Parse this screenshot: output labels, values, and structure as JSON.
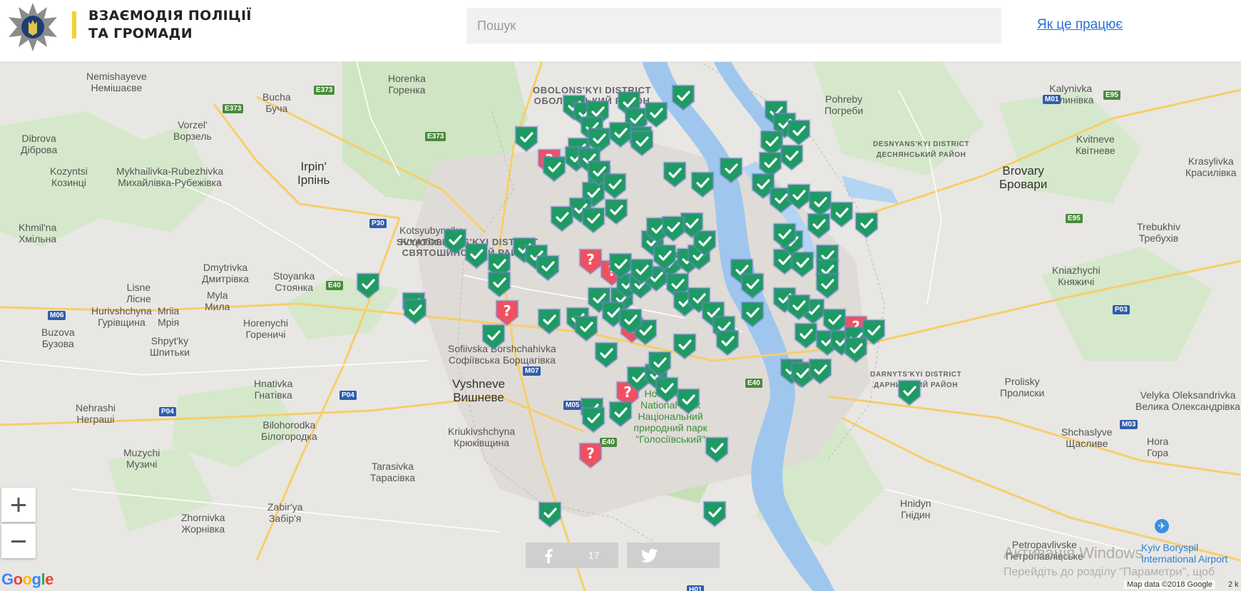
{
  "header": {
    "title_line1": "ВЗАЄМОДІЯ ПОЛІЦІЇ",
    "title_line2": "ТА ГРОМАДИ",
    "search_placeholder": "Пошук",
    "how_it_works": "Як це працює"
  },
  "map": {
    "places": [
      {
        "en": "Nemishayeve",
        "uk": "Немішаєве"
      },
      {
        "en": "Bucha",
        "uk": "Буча"
      },
      {
        "en": "Horenka",
        "uk": "Горенка"
      },
      {
        "en": "Vorzel'",
        "uk": "Ворзель"
      },
      {
        "en": "Dibrova",
        "uk": "Діброва"
      },
      {
        "en": "Kozyntsi",
        "uk": "Козинці"
      },
      {
        "en": "Mykhailivka-Rubezhivka",
        "uk": "Михайлівка-Рубежівка"
      },
      {
        "en": "Irpin'",
        "uk": "Ірпінь"
      },
      {
        "en": "Khmil'na",
        "uk": "Хмільна"
      },
      {
        "en": "Kotsyubyns'ke",
        "uk": "Коцюбинське"
      },
      {
        "en": "Dmytrivka",
        "uk": "Дмитрівка"
      },
      {
        "en": "Stoyanka",
        "uk": "Стоянка"
      },
      {
        "en": "Lisne",
        "uk": "Лісне"
      },
      {
        "en": "Myla",
        "uk": "Мила"
      },
      {
        "en": "Hurivshchyna",
        "uk": "Гурівщина"
      },
      {
        "en": "Mriia",
        "uk": "Мрія"
      },
      {
        "en": "Horenychi",
        "uk": "Гореничі"
      },
      {
        "en": "Buzova",
        "uk": "Бузова"
      },
      {
        "en": "Shpyt'ky",
        "uk": "Шпитьки"
      },
      {
        "en": "Hnativka",
        "uk": "Гнатівка"
      },
      {
        "en": "Nehrashi",
        "uk": "Неграші"
      },
      {
        "en": "Bilohorodka",
        "uk": "Білогородка"
      },
      {
        "en": "Muzychi",
        "uk": "Музичі"
      },
      {
        "en": "Zhornivka",
        "uk": "Жорнівка"
      },
      {
        "en": "Zabir'ya",
        "uk": "Забір'я"
      },
      {
        "en": "Tarasivka",
        "uk": "Тарасівка"
      },
      {
        "en": "Kriukivshchyna",
        "uk": "Крюківщина"
      },
      {
        "en": "Sofiivska Borshchahivka",
        "uk": "Софіївська Борщагівка"
      },
      {
        "en": "Pohreby",
        "uk": "Погреби"
      },
      {
        "en": "Kalynivka",
        "uk": "Калинівка"
      },
      {
        "en": "Kvitneve",
        "uk": "Квітневе"
      },
      {
        "en": "Krasylivka",
        "uk": "Красилівка"
      },
      {
        "en": "Trebukhiv",
        "uk": "Требухів"
      },
      {
        "en": "Kniazhychi",
        "uk": "Княжичі"
      },
      {
        "en": "Prolisky",
        "uk": "Пролиски"
      },
      {
        "en": "Velyka Oleksandrivka",
        "uk": "Велика Олександрівка"
      },
      {
        "en": "Shchaslyve",
        "uk": "Щасливе"
      },
      {
        "en": "Hora",
        "uk": "Гора"
      },
      {
        "en": "Hnidyn",
        "uk": "Гнідин"
      },
      {
        "en": "Petropavlivske",
        "uk": "Петропавлівське"
      }
    ],
    "big_places": [
      {
        "en": "Vyshneve",
        "uk": "Вишневе"
      },
      {
        "en": "Brovary",
        "uk": "Бровари"
      }
    ],
    "districts": [
      {
        "en": "OBOLONS'KYI DISTRICT",
        "uk": "ОБОЛОНСЬКИЙ РАЙОН"
      },
      {
        "en": "SVYATOSHYNS'KYI DISTRICT",
        "uk": "СВЯТОШИНСЬКИЙ РАЙОН"
      },
      {
        "en": "DESNYANS'KYI DISTRICT",
        "uk": "ДЕСНЯНСЬКИЙ РАЙОН"
      },
      {
        "en": "DARNYTS'KYI DISTRICT",
        "uk": "ДАРНИЦЬКИЙ РАЙОН"
      }
    ],
    "park": "Holosiivskyi National Park\nНаціональний природний парк \"Голосіївський\"",
    "roads": [
      "E373",
      "E373",
      "E373",
      "M01",
      "E95",
      "E95",
      "P30",
      "E40",
      "E40",
      "E40",
      "M06",
      "P04",
      "P04",
      "M07",
      "M03",
      "P03",
      "M05",
      "H01"
    ],
    "markers_count_note": "",
    "airport": "Kyiv Boryspil International Airport"
  },
  "share": {
    "facebook_count": "17"
  },
  "attribution": "Map data ©2018 Google",
  "attribution_extra": "2 k",
  "watermark": "Активація Windows",
  "watermark_sub": "Перейдіть до розділу \"Параметри\", щоб"
}
